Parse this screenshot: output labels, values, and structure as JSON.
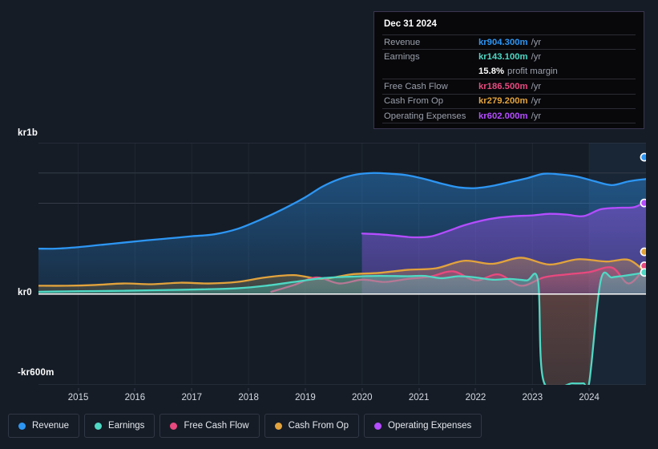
{
  "background": "#151c26",
  "tooltip": {
    "date": "Dec 31 2024",
    "rows": [
      {
        "label": "Revenue",
        "value": "kr904.300m",
        "unit": "/yr",
        "color": "#2d96f3"
      },
      {
        "label": "Earnings",
        "value": "kr143.100m",
        "unit": "/yr",
        "color": "#4fd8c4"
      },
      {
        "label": "",
        "value": "15.8%",
        "unit": "profit margin",
        "color": "#ffffff"
      },
      {
        "label": "Free Cash Flow",
        "value": "kr186.500m",
        "unit": "/yr",
        "color": "#e84a7f"
      },
      {
        "label": "Cash From Op",
        "value": "kr279.200m",
        "unit": "/yr",
        "color": "#e2a33c"
      },
      {
        "label": "Operating Expenses",
        "value": "kr602.000m",
        "unit": "/yr",
        "color": "#b44dff"
      }
    ]
  },
  "legend": {
    "items": [
      {
        "label": "Revenue",
        "color": "#2d96f3"
      },
      {
        "label": "Earnings",
        "color": "#4fd8c4"
      },
      {
        "label": "Free Cash Flow",
        "color": "#e8497e"
      },
      {
        "label": "Cash From Op",
        "color": "#e2a33c"
      },
      {
        "label": "Operating Expenses",
        "color": "#b44dff"
      }
    ]
  },
  "chart_data": {
    "type": "area",
    "title": "",
    "xlabel": "",
    "ylabel": "",
    "currency": "kr",
    "grid": true,
    "legend_position": "bottom",
    "xlim": [
      2014.3,
      2025.0
    ],
    "ylim": [
      -600,
      1000
    ],
    "y_ticks": [
      {
        "value": 1000,
        "label": "kr1b"
      },
      {
        "value": 800,
        "label": ""
      },
      {
        "value": 600,
        "label": ""
      },
      {
        "value": 0,
        "label": "kr0"
      },
      {
        "value": -600,
        "label": "-kr600m"
      }
    ],
    "x_ticks": [
      "2015",
      "2016",
      "2017",
      "2018",
      "2019",
      "2020",
      "2021",
      "2022",
      "2023",
      "2024"
    ],
    "highlight_band": {
      "from": 2024.0,
      "to": 2025.0
    },
    "series": [
      {
        "name": "Revenue",
        "color": "#2d96f3",
        "fill": "rgba(33,118,190,0.30)",
        "end_value": 904.3,
        "x": [
          2014.3,
          2014.6,
          2015.0,
          2015.4,
          2015.8,
          2016.2,
          2016.6,
          2017.0,
          2017.4,
          2017.8,
          2018.2,
          2018.6,
          2019.0,
          2019.3,
          2019.6,
          2019.9,
          2020.2,
          2020.5,
          2020.8,
          2021.1,
          2021.4,
          2021.7,
          2022.0,
          2022.3,
          2022.6,
          2022.9,
          2023.2,
          2023.5,
          2023.8,
          2024.1,
          2024.4,
          2024.7,
          2025.0
        ],
        "y": [
          300,
          300,
          310,
          325,
          340,
          355,
          368,
          382,
          395,
          430,
          490,
          560,
          640,
          710,
          760,
          790,
          800,
          795,
          785,
          760,
          730,
          705,
          700,
          715,
          740,
          765,
          795,
          790,
          775,
          745,
          720,
          745,
          760,
          904.3
        ]
      },
      {
        "name": "Operating Expenses",
        "color": "#b44dff",
        "fill": "rgba(121,72,190,0.45)",
        "end_value": 602.0,
        "x": [
          2020.0,
          2020.3,
          2020.6,
          2020.9,
          2021.2,
          2021.5,
          2021.8,
          2022.1,
          2022.4,
          2022.7,
          2023.0,
          2023.3,
          2023.6,
          2023.9,
          2024.2,
          2024.5,
          2024.8,
          2025.0
        ],
        "y": [
          400,
          395,
          385,
          375,
          380,
          415,
          455,
          485,
          505,
          515,
          520,
          530,
          525,
          515,
          560,
          570,
          575,
          615,
          602
        ]
      },
      {
        "name": "Cash From Op",
        "color": "#e2a33c",
        "fill": "rgba(185,130,80,0.30)",
        "end_value": 279.2,
        "x": [
          2014.3,
          2014.8,
          2015.3,
          2015.8,
          2016.3,
          2016.8,
          2017.3,
          2017.8,
          2018.3,
          2018.8,
          2019.3,
          2019.8,
          2020.3,
          2020.8,
          2021.3,
          2021.8,
          2022.3,
          2022.8,
          2023.3,
          2023.8,
          2024.3,
          2024.7,
          2025.0
        ],
        "y": [
          55,
          55,
          60,
          70,
          65,
          75,
          70,
          80,
          110,
          125,
          100,
          130,
          140,
          160,
          170,
          220,
          200,
          240,
          195,
          230,
          215,
          225,
          140,
          279.2
        ]
      },
      {
        "name": "Free Cash Flow",
        "color": "#e8497e",
        "fill": "rgba(190,80,120,0.25)",
        "end_value": 186.5,
        "x": [
          2018.4,
          2018.8,
          2019.2,
          2019.6,
          2020.0,
          2020.4,
          2020.8,
          2021.2,
          2021.6,
          2022.0,
          2022.4,
          2022.8,
          2023.2,
          2023.6,
          2024.0,
          2024.4,
          2024.7,
          2025.0
        ],
        "y": [
          15,
          60,
          110,
          70,
          95,
          80,
          100,
          115,
          150,
          90,
          130,
          55,
          110,
          130,
          145,
          175,
          70,
          186.5
        ]
      },
      {
        "name": "Earnings",
        "color": "#4fd8c4",
        "fill": "rgba(70,170,155,0.30)",
        "end_value": 143.1,
        "x": [
          2014.3,
          2014.8,
          2015.3,
          2015.8,
          2016.3,
          2016.8,
          2017.3,
          2017.8,
          2018.3,
          2018.8,
          2019.3,
          2019.8,
          2020.3,
          2020.8,
          2021.1,
          2021.4,
          2021.7,
          2022.0,
          2022.3,
          2022.6,
          2022.9,
          2023.1,
          2023.2,
          2023.7,
          2023.9,
          2024.0,
          2024.2,
          2024.4,
          2024.6,
          2025.0
        ],
        "y": [
          15,
          18,
          20,
          22,
          25,
          28,
          32,
          38,
          55,
          80,
          105,
          115,
          120,
          118,
          120,
          105,
          118,
          110,
          95,
          100,
          90,
          85,
          -580,
          -590,
          -590,
          -585,
          85,
          110,
          120,
          143.1
        ]
      }
    ]
  }
}
